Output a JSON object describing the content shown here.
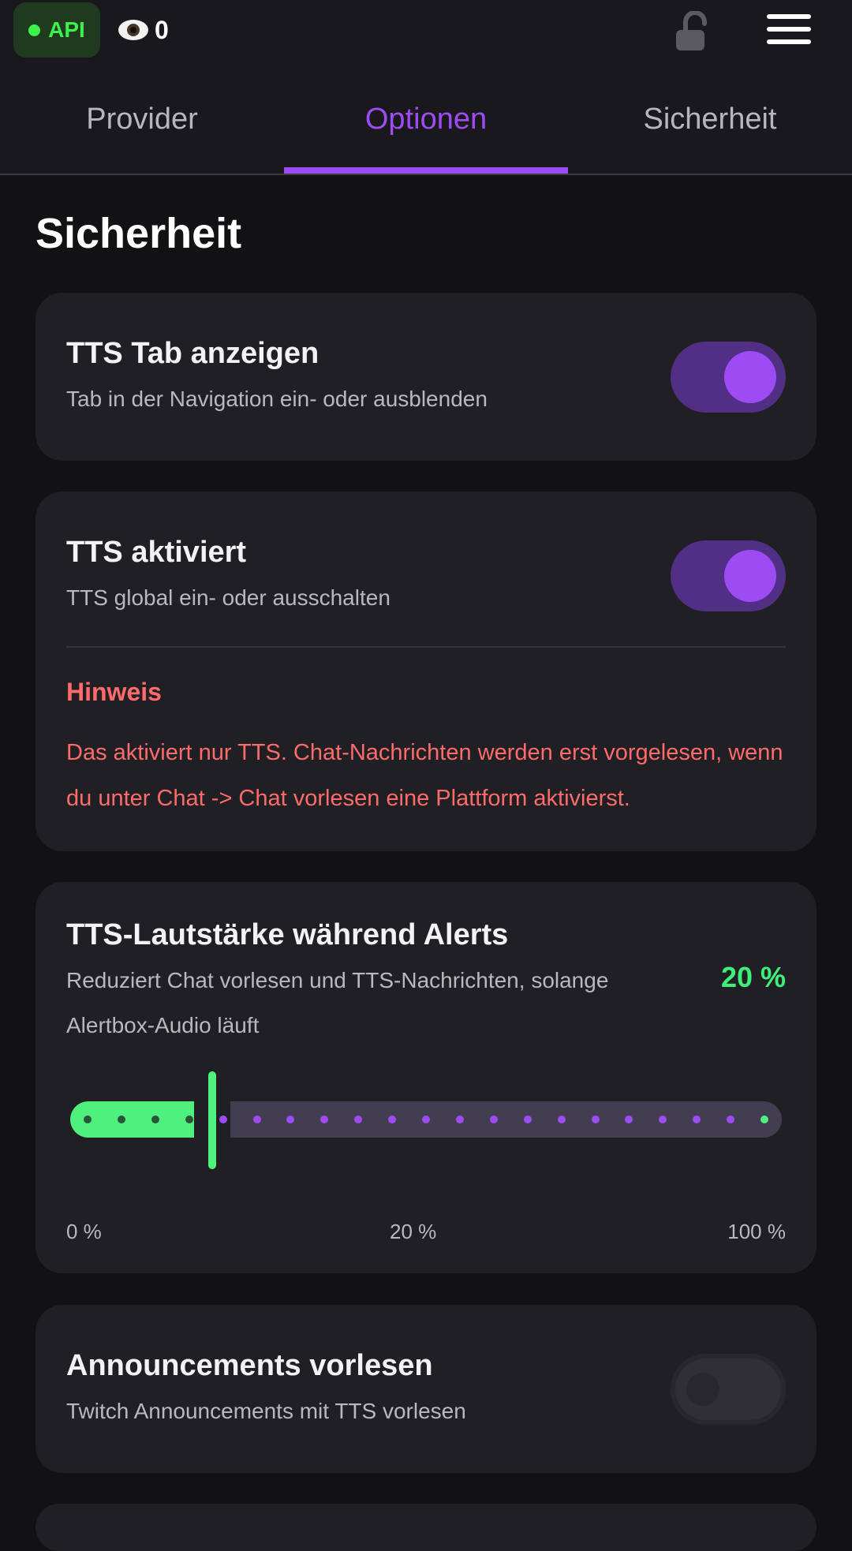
{
  "header": {
    "api_label": "API",
    "viewer_count": "0",
    "colors": {
      "api_green": "#3df04a",
      "accent": "#9d4cf4"
    },
    "icons": [
      "eye-icon",
      "lock-open-icon",
      "hamburger-menu-icon"
    ]
  },
  "tabs": [
    {
      "label": "Provider",
      "active": false
    },
    {
      "label": "Optionen",
      "active": true
    },
    {
      "label": "Sicherheit",
      "active": false
    }
  ],
  "page": {
    "title": "Sicherheit"
  },
  "cards": {
    "tts_tab": {
      "title": "TTS Tab anzeigen",
      "desc": "Tab in der Navigation ein- oder ausblenden",
      "enabled": true
    },
    "tts_active": {
      "title": "TTS aktiviert",
      "desc": "TTS global ein- oder ausschalten",
      "enabled": true,
      "hint_title": "Hinweis",
      "hint_text": "Das aktiviert nur TTS. Chat-Nachrichten werden erst vorgelesen, wenn du unter Chat -> Chat vorlesen eine Plattform aktivierst."
    },
    "volume": {
      "title": "TTS-Lautstärke während Alerts",
      "desc": "Reduziert Chat vorlesen und TTS-Nachrichten, solange Alertbox-Audio läuft",
      "value_label": "20 %",
      "value": 20,
      "min_label": "0 %",
      "mid_label": "20 %",
      "max_label": "100 %",
      "colors": {
        "fill": "#4ff07e",
        "track": "#423d50"
      }
    },
    "announcements": {
      "title": "Announcements vorlesen",
      "desc": "Twitch Announcements mit TTS vorlesen",
      "enabled": false
    }
  }
}
